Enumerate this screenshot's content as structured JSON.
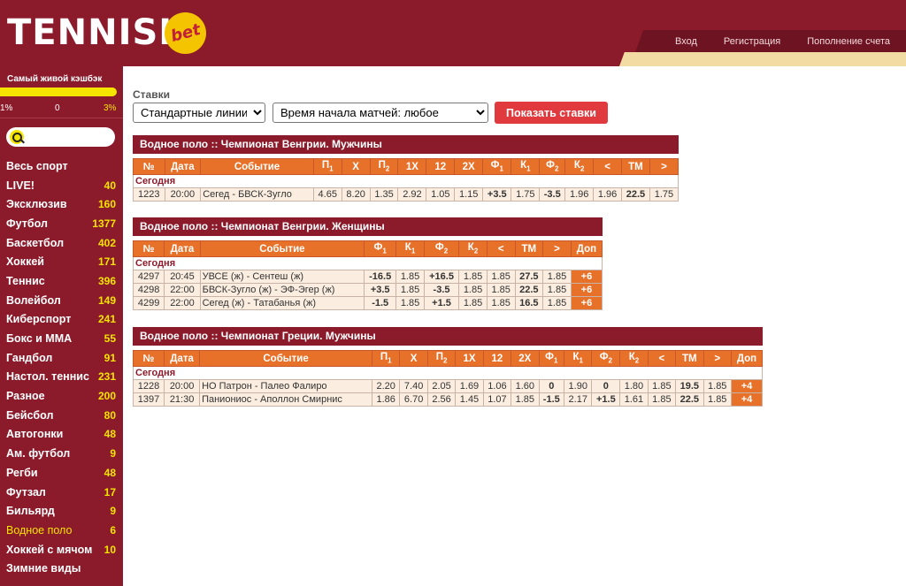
{
  "brand": {
    "logo_text": "TENNISI",
    "badge": "bet"
  },
  "topnav": {
    "login": "Вход",
    "register": "Регистрация",
    "deposit": "Пополнение счета"
  },
  "sidebar": {
    "cashback_title": "Самый живой кэшбэк",
    "cashback_scale": {
      "left": "1%",
      "mid": "0",
      "right": "3%"
    },
    "search_placeholder": "",
    "sports": [
      {
        "name": "Весь спорт",
        "count": ""
      },
      {
        "name": "LIVE!",
        "count": "40"
      },
      {
        "name": "Эксклюзив",
        "count": "160"
      },
      {
        "name": "Футбол",
        "count": "1377"
      },
      {
        "name": "Баскетбол",
        "count": "402"
      },
      {
        "name": "Хоккей",
        "count": "171"
      },
      {
        "name": "Теннис",
        "count": "396"
      },
      {
        "name": "Волейбол",
        "count": "149"
      },
      {
        "name": "Киберспорт",
        "count": "241"
      },
      {
        "name": "Бокс и ММА",
        "count": "55"
      },
      {
        "name": "Гандбол",
        "count": "91"
      },
      {
        "name": "Настол. теннис",
        "count": "231"
      },
      {
        "name": "Разное",
        "count": "200"
      },
      {
        "name": "Бейсбол",
        "count": "80"
      },
      {
        "name": "Автогонки",
        "count": "48"
      },
      {
        "name": "Ам. футбол",
        "count": "9"
      },
      {
        "name": "Регби",
        "count": "48"
      },
      {
        "name": "Футзал",
        "count": "17"
      },
      {
        "name": "Бильярд",
        "count": "9"
      },
      {
        "name": "Водное поло",
        "count": "6",
        "active": true
      },
      {
        "name": "Хоккей с мячом",
        "count": "10"
      },
      {
        "name": "Зимние виды",
        "count": ""
      }
    ]
  },
  "filters": {
    "label": "Ставки",
    "lines_select": "Стандартные линии",
    "time_select": "Время начала матчей: любое",
    "show_button": "Показать ставки"
  },
  "today_label": "Сегодня",
  "leagues": [
    {
      "title": "Водное поло :: Чемпионат Венгрии. Мужчины",
      "headers": [
        "№",
        "Дата",
        "Событие",
        "П1",
        "X",
        "П2",
        "1X",
        "12",
        "2X",
        "Ф1",
        "К1",
        "Ф2",
        "К2",
        "<",
        "ТМ",
        ">"
      ],
      "rows": [
        [
          "1223",
          "20:00",
          "Сегед - БВСК-Зугло",
          "4.65",
          "8.20",
          "1.35",
          "2.92",
          "1.05",
          "1.15",
          "+3.5",
          "1.75",
          "-3.5",
          "1.96",
          "1.96",
          "22.5",
          "1.75"
        ]
      ]
    },
    {
      "title": "Водное поло :: Чемпионат Венгрии. Женщины",
      "headers": [
        "№",
        "Дата",
        "Событие",
        "Ф1",
        "К1",
        "Ф2",
        "К2",
        "<",
        "ТМ",
        ">",
        "Доп"
      ],
      "rows": [
        [
          "4297",
          "20:45",
          "УВСЕ (ж) - Сентеш (ж)",
          "-16.5",
          "1.85",
          "+16.5",
          "1.85",
          "1.85",
          "27.5",
          "1.85",
          "+6"
        ],
        [
          "4298",
          "22:00",
          "БВСК-Зугло (ж) - ЭФ-Эгер (ж)",
          "+3.5",
          "1.85",
          "-3.5",
          "1.85",
          "1.85",
          "22.5",
          "1.85",
          "+6"
        ],
        [
          "4299",
          "22:00",
          "Сегед (ж) - Татабанья (ж)",
          "-1.5",
          "1.85",
          "+1.5",
          "1.85",
          "1.85",
          "16.5",
          "1.85",
          "+6"
        ]
      ]
    },
    {
      "title": "Водное поло :: Чемпионат Греции. Мужчины",
      "headers": [
        "№",
        "Дата",
        "Событие",
        "П1",
        "X",
        "П2",
        "1X",
        "12",
        "2X",
        "Ф1",
        "К1",
        "Ф2",
        "К2",
        "<",
        "ТМ",
        ">",
        "Доп"
      ],
      "rows": [
        [
          "1228",
          "20:00",
          "НО Патрон - Палео Фалиро",
          "2.20",
          "7.40",
          "2.05",
          "1.69",
          "1.06",
          "1.60",
          "0",
          "1.90",
          "0",
          "1.80",
          "1.85",
          "19.5",
          "1.85",
          "+4"
        ],
        [
          "1397",
          "21:30",
          "Паниониос - Аполлон Смирнис",
          "1.86",
          "6.70",
          "2.56",
          "1.45",
          "1.07",
          "1.85",
          "-1.5",
          "2.17",
          "+1.5",
          "1.61",
          "1.85",
          "22.5",
          "1.85",
          "+4"
        ]
      ]
    }
  ],
  "colors": {
    "brand": "#8b1a2b",
    "accent": "#e8712a",
    "highlight": "#f5e400",
    "button": "#e0393e"
  }
}
